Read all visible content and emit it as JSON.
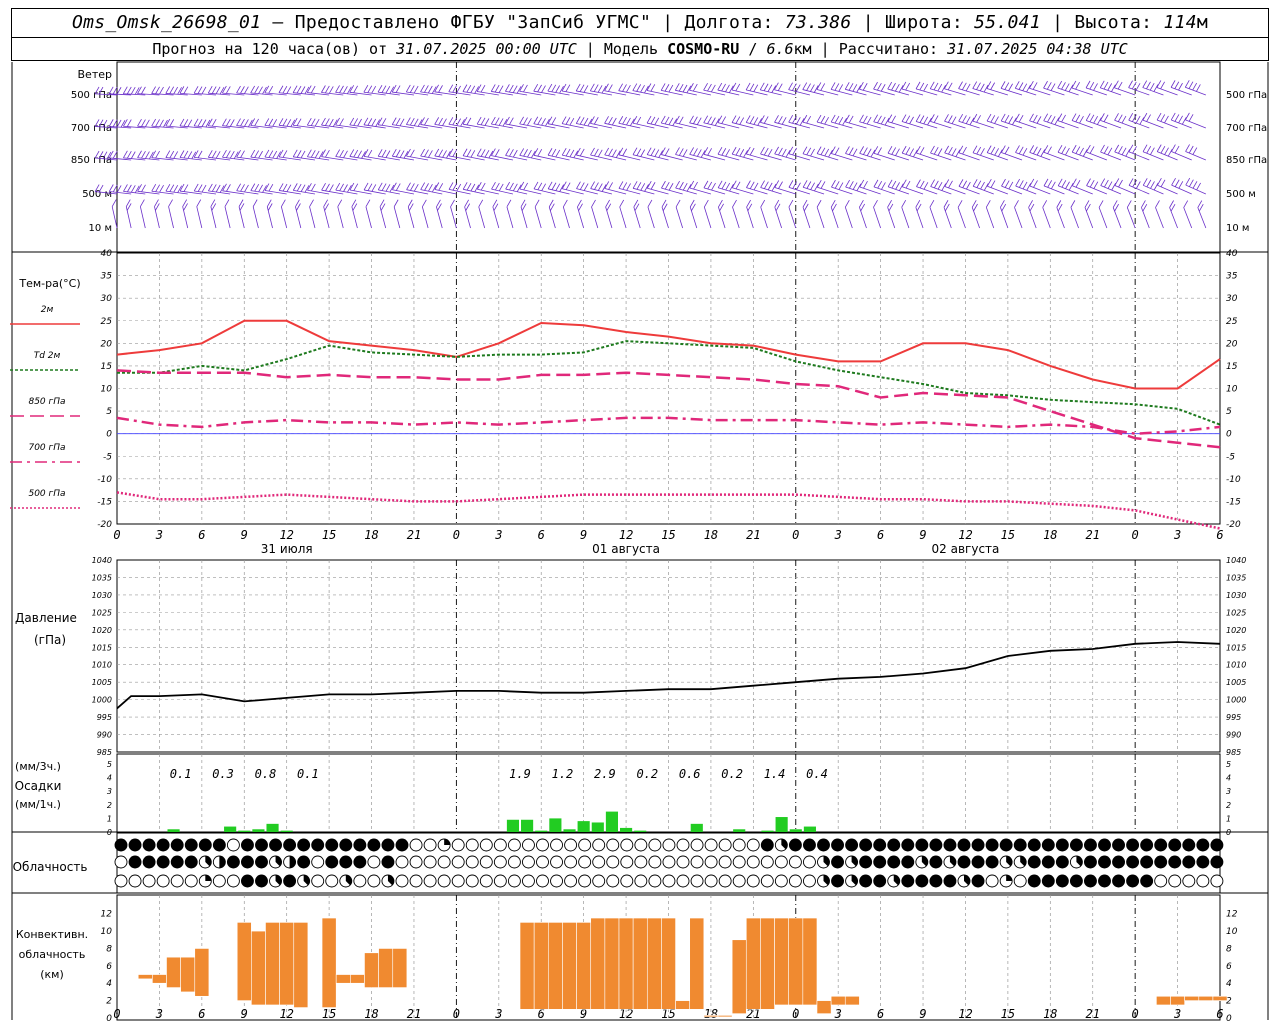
{
  "header": {
    "station": "Oms_Omsk_26698_01",
    "provided_by": "– Предоставлено ФГБУ \"ЗапСиб УГМС\"",
    "lon_label": "Долгота:",
    "lon": "73.386",
    "lat_label": "Широта:",
    "lat": "55.041",
    "alt_label": "Высота:",
    "alt": "114",
    "alt_unit": "м",
    "forecast_text": "Прогноз на 120 часа(ов) от",
    "run_time": "31.07.2025 00:00 UTC",
    "model_label": "Модель",
    "model": "COSMO-RU",
    "resolution": "6.6",
    "resolution_unit": "км",
    "calc_label": "Рассчитано:",
    "calc_time": "31.07.2025 04:38 UTC"
  },
  "colors": {
    "wind": "#6a2fc9",
    "t2m": "#ee3b3b",
    "td2m": "#1e7a1e",
    "t850": "#e0287a",
    "t700": "#e0287a",
    "t500": "#e0287a",
    "zero_line": "#4040ff",
    "pressure": "#000000",
    "precip": "#22cc22",
    "convective": "#f08a30",
    "grid": "#999999"
  },
  "x_axis": {
    "hour_ticks": [
      "0",
      "3",
      "6",
      "9",
      "12",
      "15",
      "18",
      "21",
      "0",
      "3",
      "6",
      "9",
      "12",
      "15",
      "18",
      "21",
      "0",
      "3",
      "6",
      "9",
      "12",
      "15",
      "18",
      "21",
      "0",
      "3",
      "6"
    ],
    "day_labels": [
      "31 июля",
      "01 августа",
      "02 августа"
    ]
  },
  "chart_data": [
    {
      "type": "wind-barbs",
      "title": "Ветер",
      "levels": [
        "500 гПа",
        "700 гПа",
        "850 гПа",
        "500 м",
        "10 м"
      ]
    },
    {
      "type": "line",
      "title": "Тем-ра(°C)",
      "ylim": [
        -20,
        40
      ],
      "yticks": [
        -20,
        -15,
        -10,
        -5,
        0,
        5,
        10,
        15,
        20,
        25,
        30,
        35,
        40
      ],
      "x_unit": "hours since 31.07.2025 00:00 UTC",
      "series": [
        {
          "name": "2м",
          "x": [
            0,
            3,
            6,
            9,
            12,
            15,
            18,
            21,
            24,
            27,
            30,
            33,
            36,
            39,
            42,
            45,
            48,
            51,
            54,
            57,
            60,
            63,
            66,
            69,
            72,
            75,
            78
          ],
          "values": [
            17.5,
            18.5,
            20,
            25,
            25,
            20.5,
            19.5,
            18.5,
            17,
            20,
            24.5,
            24,
            22.5,
            21.5,
            20,
            19.5,
            17.5,
            16,
            16,
            20,
            20,
            18.5,
            15,
            12,
            10,
            10,
            16.5
          ]
        },
        {
          "name": "Td 2м",
          "x": [
            0,
            3,
            6,
            9,
            12,
            15,
            18,
            21,
            24,
            27,
            30,
            33,
            36,
            39,
            42,
            45,
            48,
            51,
            54,
            57,
            60,
            63,
            66,
            69,
            72,
            75,
            78
          ],
          "values": [
            13.5,
            13.5,
            15,
            14,
            16.5,
            19.5,
            18,
            17.5,
            17,
            17.5,
            17.5,
            18,
            20.5,
            20,
            19.5,
            19,
            16,
            14,
            12.5,
            11,
            9,
            8.5,
            7.5,
            7,
            6.5,
            5.5,
            2
          ]
        },
        {
          "name": "850 гПа",
          "x": [
            0,
            3,
            6,
            9,
            12,
            15,
            18,
            21,
            24,
            27,
            30,
            33,
            36,
            39,
            42,
            45,
            48,
            51,
            54,
            57,
            60,
            63,
            66,
            69,
            72,
            75,
            78
          ],
          "values": [
            14,
            13.5,
            13.5,
            13.5,
            12.5,
            13,
            12.5,
            12.5,
            12,
            12,
            13,
            13,
            13.5,
            13,
            12.5,
            12,
            11,
            10.5,
            8,
            9,
            8.5,
            8,
            5,
            2,
            -1,
            -2,
            -3
          ]
        },
        {
          "name": "700 гПа",
          "x": [
            0,
            3,
            6,
            9,
            12,
            15,
            18,
            21,
            24,
            27,
            30,
            33,
            36,
            39,
            42,
            45,
            48,
            51,
            54,
            57,
            60,
            63,
            66,
            69,
            72,
            75,
            78
          ],
          "values": [
            3.5,
            2,
            1.5,
            2.5,
            3,
            2.5,
            2.5,
            2,
            2.5,
            2,
            2.5,
            3,
            3.5,
            3.5,
            3,
            3,
            3,
            2.5,
            2,
            2.5,
            2,
            1.5,
            2,
            1.5,
            0,
            0.5,
            1.5
          ]
        },
        {
          "name": "500 гПа",
          "x": [
            0,
            3,
            6,
            9,
            12,
            15,
            18,
            21,
            24,
            27,
            30,
            33,
            36,
            39,
            42,
            45,
            48,
            51,
            54,
            57,
            60,
            63,
            66,
            69,
            72,
            75,
            78
          ],
          "values": [
            -13,
            -14.5,
            -14.5,
            -14,
            -13.5,
            -14,
            -14.5,
            -15,
            -15,
            -14.5,
            -14,
            -13.5,
            -13.5,
            -13.5,
            -13.5,
            -13.5,
            -13.5,
            -14,
            -14.5,
            -14.5,
            -15,
            -15,
            -15.5,
            -16,
            -17,
            -19,
            -21
          ]
        }
      ]
    },
    {
      "type": "line",
      "title": "Давление",
      "unit": "(гПа)",
      "ylim": [
        985,
        1040
      ],
      "yticks": [
        985,
        990,
        995,
        1000,
        1005,
        1010,
        1015,
        1020,
        1025,
        1030,
        1035,
        1040
      ],
      "x_unit": "hours since 31.07.2025 00:00 UTC",
      "series": [
        {
          "x": [
            0,
            1,
            3,
            6,
            9,
            12,
            15,
            18,
            21,
            24,
            27,
            30,
            33,
            36,
            39,
            42,
            45,
            48,
            51,
            54,
            57,
            60,
            63,
            66,
            69,
            72,
            75,
            78
          ],
          "values": [
            997.5,
            1001,
            1001,
            1001.5,
            999.5,
            1000.5,
            1001.5,
            1001.5,
            1002,
            1002.5,
            1002.5,
            1002,
            1002,
            1002.5,
            1003,
            1003,
            1004,
            1005,
            1006,
            1006.5,
            1007.5,
            1009,
            1012.5,
            1014,
            1014.5,
            1016,
            1016.5,
            1016
          ]
        }
      ]
    },
    {
      "type": "bar",
      "title": "Осадки",
      "unit_3h": "(мм/3ч.)",
      "unit_1h": "(мм/1ч.)",
      "ylim": [
        0,
        5
      ],
      "yticks": [
        0,
        1,
        2,
        3,
        4,
        5
      ],
      "totals_3h": [
        {
          "x": 4.5,
          "text": "0.1"
        },
        {
          "x": 7.5,
          "text": "0.3"
        },
        {
          "x": 10.5,
          "text": "0.8"
        },
        {
          "x": 13.5,
          "text": "0.1"
        },
        {
          "x": 28.5,
          "text": "1.9"
        },
        {
          "x": 31.5,
          "text": "1.2"
        },
        {
          "x": 34.5,
          "text": "2.9"
        },
        {
          "x": 37.5,
          "text": "0.2"
        },
        {
          "x": 40.5,
          "text": "0.6"
        },
        {
          "x": 43.5,
          "text": "0.2"
        },
        {
          "x": 46.5,
          "text": "1.4"
        },
        {
          "x": 49.5,
          "text": "0.4"
        }
      ],
      "hourly": {
        "x": [
          4,
          8,
          9,
          10,
          11,
          12,
          28,
          29,
          30,
          31,
          32,
          33,
          34,
          35,
          36,
          37,
          41,
          44,
          46,
          47,
          48,
          49
        ],
        "values": [
          0.2,
          0.4,
          0.1,
          0.2,
          0.6,
          0.1,
          0.9,
          0.9,
          0.1,
          1.0,
          0.2,
          0.8,
          0.7,
          1.5,
          0.3,
          0.1,
          0.6,
          0.2,
          0.1,
          1.1,
          0.2,
          0.4
        ]
      }
    },
    {
      "type": "table",
      "title": "Облачность",
      "note": "cloud cover per hour, 3 layers (upper, middle, lower), oktas 0-8",
      "rows": [
        "888888880888888888888002000000000000000000000083888888888888888888888888888888800000200062630000000000000000",
        "088888348883480888080000000000000000000000000000003838888383888338883888888888802040000000000000000000000000",
        "000000200883830030030000000000000000000000000000003838838888380208888888880000000000000000000000000000000000888888888888"
      ]
    },
    {
      "type": "bar",
      "title": "Конвективн. облачность",
      "unit": "(км)",
      "ylim": [
        0,
        13
      ],
      "yticks": [
        0,
        2,
        4,
        6,
        8,
        10,
        12
      ],
      "note": "each bar spans from cloud base to cloud top",
      "base": [
        4.5,
        4,
        3.5,
        3,
        2.5,
        2,
        1.5,
        1.5,
        1.5,
        1.2,
        1.2,
        4,
        4,
        3.5,
        3.5,
        3.5,
        1,
        1,
        1,
        1,
        1,
        1,
        1,
        1,
        1,
        1,
        1,
        1,
        1,
        0.2,
        0.2,
        0.5,
        1,
        1,
        1.5,
        1.5,
        1.5,
        0.5,
        1.5,
        1.5,
        1.5,
        1.5,
        2,
        2,
        2,
        2
      ],
      "top": [
        5,
        5,
        7,
        7,
        8,
        11,
        10,
        11,
        11,
        11,
        11.5,
        5,
        5,
        7.5,
        8,
        8,
        11,
        11,
        11,
        11,
        11,
        11.5,
        11.5,
        11.5,
        11.5,
        11.5,
        11.5,
        2,
        11.5,
        0.3,
        0.3,
        9,
        11.5,
        11.5,
        11.5,
        11.5,
        11.5,
        2,
        2.5,
        2.5,
        2.5,
        2.5,
        2.5,
        2.5,
        2.5,
        2.5
      ],
      "x": [
        2,
        3,
        4,
        5,
        6,
        9,
        10,
        11,
        12,
        13,
        15,
        16,
        17,
        18,
        19,
        20,
        29,
        30,
        31,
        32,
        33,
        34,
        35,
        36,
        37,
        38,
        39,
        40,
        41,
        42,
        43,
        44,
        45,
        46,
        47,
        48,
        49,
        50,
        51,
        52,
        74,
        75,
        76,
        77,
        78,
        78
      ]
    }
  ]
}
